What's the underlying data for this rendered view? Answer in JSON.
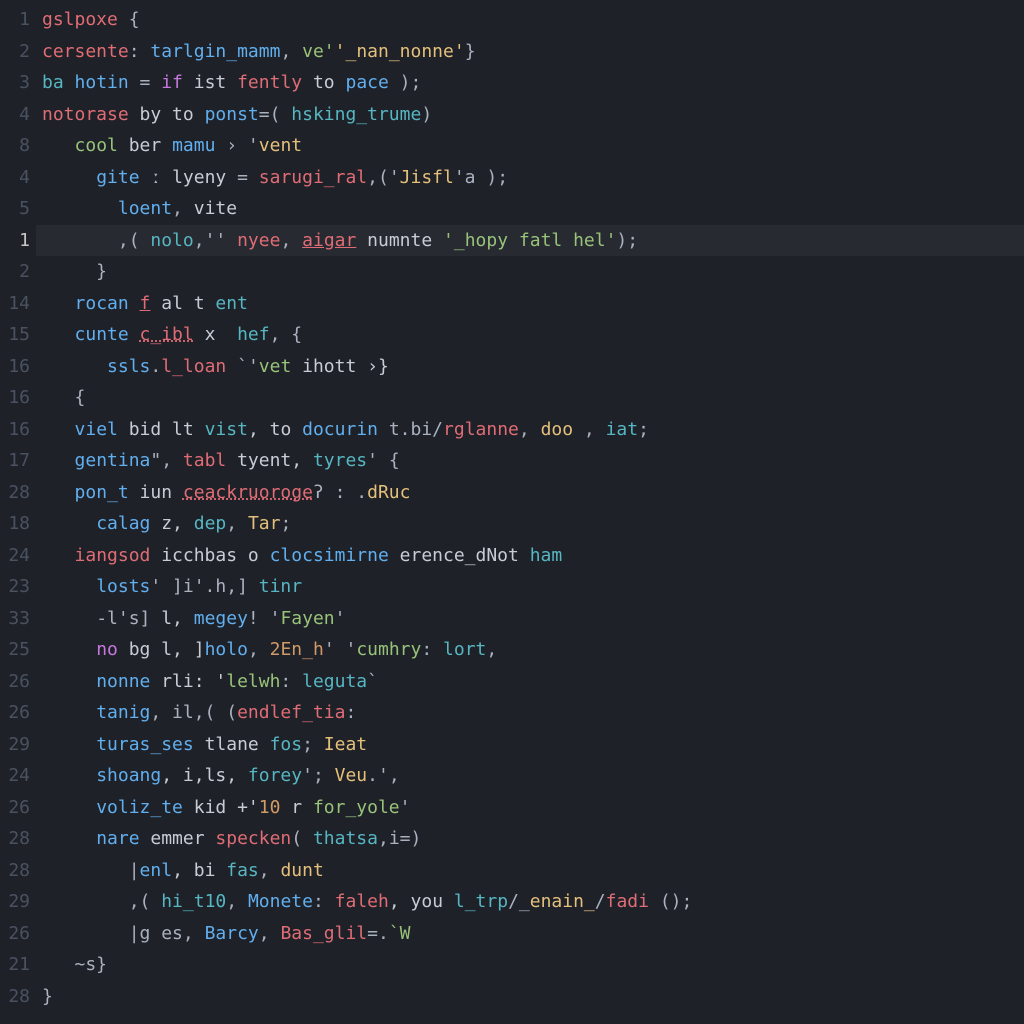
{
  "theme": {
    "background": "#1e2128",
    "gutter": "#4a5260",
    "highlight_row_index": 7
  },
  "lines": [
    {
      "num": "1",
      "tokens": [
        {
          "t": "gslpoxe",
          "c": "var"
        },
        {
          "t": " {",
          "c": "op"
        }
      ]
    },
    {
      "num": "2",
      "tokens": [
        {
          "t": "cersente",
          "c": "var"
        },
        {
          "t": ": ",
          "c": "op"
        },
        {
          "t": "tarlgin_mamm",
          "c": "fn"
        },
        {
          "t": ", ",
          "c": "op"
        },
        {
          "t": "ve'",
          "c": "str"
        },
        {
          "t": "'_nan_nonne'",
          "c": "warn"
        },
        {
          "t": "}",
          "c": "op"
        }
      ]
    },
    {
      "num": "3",
      "tokens": [
        {
          "t": "ba ",
          "c": "id"
        },
        {
          "t": "hotin",
          "c": "fn"
        },
        {
          "t": " = ",
          "c": "op"
        },
        {
          "t": "if",
          "c": "kw"
        },
        {
          "t": " ist ",
          "c": "mut"
        },
        {
          "t": "fently",
          "c": "var"
        },
        {
          "t": " to ",
          "c": "mut"
        },
        {
          "t": "pace",
          "c": "fn"
        },
        {
          "t": " );",
          "c": "op"
        }
      ]
    },
    {
      "num": "4",
      "tokens": [
        {
          "t": "notorase",
          "c": "var"
        },
        {
          "t": " by to ",
          "c": "mut"
        },
        {
          "t": "ponst",
          "c": "fn"
        },
        {
          "t": "=( ",
          "c": "op"
        },
        {
          "t": "hsking_trume",
          "c": "id"
        },
        {
          "t": ")",
          "c": "op"
        }
      ]
    },
    {
      "num": "8",
      "tokens": [
        {
          "t": "   ",
          "c": "op"
        },
        {
          "t": "cool",
          "c": "str"
        },
        {
          "t": " ber ",
          "c": "mut"
        },
        {
          "t": "mamu",
          "c": "fn"
        },
        {
          "t": " › '",
          "c": "op"
        },
        {
          "t": "vent",
          "c": "warn"
        }
      ]
    },
    {
      "num": "4",
      "tokens": [
        {
          "t": "     ",
          "c": "op"
        },
        {
          "t": "gite",
          "c": "fn"
        },
        {
          "t": " ː ",
          "c": "op"
        },
        {
          "t": "lyeny",
          "c": "mut"
        },
        {
          "t": " = ",
          "c": "op"
        },
        {
          "t": "sarugi_ral",
          "c": "var"
        },
        {
          "t": ",('",
          "c": "op"
        },
        {
          "t": "Jisfl",
          "c": "warn"
        },
        {
          "t": "'a );",
          "c": "op"
        }
      ]
    },
    {
      "num": "5",
      "tokens": [
        {
          "t": "       ",
          "c": "op"
        },
        {
          "t": "loent",
          "c": "fn"
        },
        {
          "t": ", ",
          "c": "op"
        },
        {
          "t": "vite",
          "c": "mut"
        }
      ]
    },
    {
      "num": "1",
      "tokens": [
        {
          "t": "       ,( ",
          "c": "op"
        },
        {
          "t": "nolo",
          "c": "id"
        },
        {
          "t": ",'' ",
          "c": "op"
        },
        {
          "t": "nyee",
          "c": "var"
        },
        {
          "t": ", ",
          "c": "op"
        },
        {
          "t": "aigar",
          "c": "var und"
        },
        {
          "t": " numnte ",
          "c": "mut"
        },
        {
          "t": "'_hopy fatl hel'",
          "c": "str"
        },
        {
          "t": ");",
          "c": "op"
        }
      ]
    },
    {
      "num": "2",
      "tokens": [
        {
          "t": "     }",
          "c": "op"
        }
      ]
    },
    {
      "num": "14",
      "tokens": [
        {
          "t": "   ",
          "c": "op"
        },
        {
          "t": "rocan ",
          "c": "fn"
        },
        {
          "t": "f",
          "c": "var und"
        },
        {
          "t": " al t ",
          "c": "mut"
        },
        {
          "t": "ent",
          "c": "id"
        }
      ]
    },
    {
      "num": "15",
      "tokens": [
        {
          "t": "   ",
          "c": "op"
        },
        {
          "t": "cunte ",
          "c": "fn"
        },
        {
          "t": "c_ibl",
          "c": "var und2"
        },
        {
          "t": " x  ",
          "c": "mut"
        },
        {
          "t": "hef",
          "c": "id"
        },
        {
          "t": ", {",
          "c": "op"
        }
      ]
    },
    {
      "num": "16",
      "tokens": [
        {
          "t": "      ",
          "c": "op"
        },
        {
          "t": "ssls",
          "c": "fn"
        },
        {
          "t": ".",
          "c": "op"
        },
        {
          "t": "l_loan",
          "c": "var"
        },
        {
          "t": " `'",
          "c": "op"
        },
        {
          "t": "vet",
          "c": "str"
        },
        {
          "t": " ihott ›}",
          "c": "mut"
        }
      ]
    },
    {
      "num": "16",
      "tokens": [
        {
          "t": "   {",
          "c": "op"
        }
      ]
    },
    {
      "num": "16",
      "tokens": [
        {
          "t": "   ",
          "c": "op"
        },
        {
          "t": "viel",
          "c": "fn"
        },
        {
          "t": " bid lt ",
          "c": "mut"
        },
        {
          "t": "vist",
          "c": "id"
        },
        {
          "t": ", to ",
          "c": "mut"
        },
        {
          "t": "docurin",
          "c": "fn"
        },
        {
          "t": " t.bi/",
          "c": "op"
        },
        {
          "t": "rglanne",
          "c": "var"
        },
        {
          "t": ", ",
          "c": "op"
        },
        {
          "t": "doo",
          "c": "warn"
        },
        {
          "t": " , ",
          "c": "op"
        },
        {
          "t": "iat",
          "c": "id"
        },
        {
          "t": ";",
          "c": "op"
        }
      ]
    },
    {
      "num": "17",
      "tokens": [
        {
          "t": "   ",
          "c": "op"
        },
        {
          "t": "gentina",
          "c": "fn"
        },
        {
          "t": "\", ",
          "c": "op"
        },
        {
          "t": "tabl",
          "c": "var"
        },
        {
          "t": " tyent, ",
          "c": "mut"
        },
        {
          "t": "tyres",
          "c": "id"
        },
        {
          "t": "' {",
          "c": "op"
        }
      ]
    },
    {
      "num": "28",
      "tokens": [
        {
          "t": "   ",
          "c": "op"
        },
        {
          "t": "pon_t",
          "c": "fn"
        },
        {
          "t": " iun ",
          "c": "mut"
        },
        {
          "t": "ceackruoroge",
          "c": "var und2"
        },
        {
          "t": "ʔ : .",
          "c": "op"
        },
        {
          "t": "dRuc",
          "c": "warn"
        }
      ]
    },
    {
      "num": "18",
      "tokens": [
        {
          "t": "     ",
          "c": "op"
        },
        {
          "t": "calag",
          "c": "fn"
        },
        {
          "t": " z, ",
          "c": "mut"
        },
        {
          "t": "dep",
          "c": "id"
        },
        {
          "t": ", ",
          "c": "op"
        },
        {
          "t": "Tar",
          "c": "warn"
        },
        {
          "t": ";",
          "c": "op"
        }
      ]
    },
    {
      "num": "24",
      "tokens": [
        {
          "t": "   ",
          "c": "op"
        },
        {
          "t": "iangsod",
          "c": "var"
        },
        {
          "t": " icchbas o ",
          "c": "mut"
        },
        {
          "t": "clocsimirne",
          "c": "fn"
        },
        {
          "t": " erence_dNot ",
          "c": "mut"
        },
        {
          "t": "ham",
          "c": "id"
        }
      ]
    },
    {
      "num": "23",
      "tokens": [
        {
          "t": "     ",
          "c": "op"
        },
        {
          "t": "losts",
          "c": "fn"
        },
        {
          "t": "' ]i'.h,] ",
          "c": "op"
        },
        {
          "t": "tinr",
          "c": "id"
        }
      ]
    },
    {
      "num": "33",
      "tokens": [
        {
          "t": "     ",
          "c": "op"
        },
        {
          "t": "-l's]",
          "c": "op"
        },
        {
          "t": " l, ",
          "c": "mut"
        },
        {
          "t": "megey",
          "c": "fn"
        },
        {
          "t": "! '",
          "c": "op"
        },
        {
          "t": "Fayen",
          "c": "str"
        },
        {
          "t": "'",
          "c": "op"
        }
      ]
    },
    {
      "num": "25",
      "tokens": [
        {
          "t": "     ",
          "c": "op"
        },
        {
          "t": "no",
          "c": "kw"
        },
        {
          "t": " bg l, ]",
          "c": "mut"
        },
        {
          "t": "holo",
          "c": "fn"
        },
        {
          "t": ", ",
          "c": "op"
        },
        {
          "t": "2En_h",
          "c": "num"
        },
        {
          "t": "' '",
          "c": "op"
        },
        {
          "t": "cumhry",
          "c": "str"
        },
        {
          "t": ": ",
          "c": "op"
        },
        {
          "t": "lort",
          "c": "id"
        },
        {
          "t": ",",
          "c": "op"
        }
      ]
    },
    {
      "num": "26",
      "tokens": [
        {
          "t": "     ",
          "c": "op"
        },
        {
          "t": "nonne",
          "c": "fn"
        },
        {
          "t": " rli: '",
          "c": "mut"
        },
        {
          "t": "lelwh",
          "c": "str"
        },
        {
          "t": ": ",
          "c": "op"
        },
        {
          "t": "leguta",
          "c": "id"
        },
        {
          "t": "`",
          "c": "op"
        }
      ]
    },
    {
      "num": "26",
      "tokens": [
        {
          "t": "     ",
          "c": "op"
        },
        {
          "t": "tanig",
          "c": "fn"
        },
        {
          "t": ", il,( (",
          "c": "op"
        },
        {
          "t": "endlef_tia",
          "c": "var"
        },
        {
          "t": ":",
          "c": "op"
        }
      ]
    },
    {
      "num": "29",
      "tokens": [
        {
          "t": "     ",
          "c": "op"
        },
        {
          "t": "turas_ses",
          "c": "fn"
        },
        {
          "t": " tlane ",
          "c": "mut"
        },
        {
          "t": "fos",
          "c": "id"
        },
        {
          "t": "; ",
          "c": "op"
        },
        {
          "t": "Ieat",
          "c": "warn"
        }
      ]
    },
    {
      "num": "24",
      "tokens": [
        {
          "t": "     ",
          "c": "op"
        },
        {
          "t": "shoang",
          "c": "fn"
        },
        {
          "t": ", i,ls, ",
          "c": "mut"
        },
        {
          "t": "forey",
          "c": "id"
        },
        {
          "t": "'; ",
          "c": "op"
        },
        {
          "t": "Veu",
          "c": "warn"
        },
        {
          "t": ".',",
          "c": "op"
        }
      ]
    },
    {
      "num": "26",
      "tokens": [
        {
          "t": "     ",
          "c": "op"
        },
        {
          "t": "voliz_te",
          "c": "fn"
        },
        {
          "t": " kid +'",
          "c": "mut"
        },
        {
          "t": "10",
          "c": "num"
        },
        {
          "t": " r ",
          "c": "mut"
        },
        {
          "t": "for_yole",
          "c": "str"
        },
        {
          "t": "'",
          "c": "op"
        }
      ]
    },
    {
      "num": "28",
      "tokens": [
        {
          "t": "     ",
          "c": "op"
        },
        {
          "t": "nare",
          "c": "fn"
        },
        {
          "t": " emmer ",
          "c": "mut"
        },
        {
          "t": "specken",
          "c": "var"
        },
        {
          "t": "( ",
          "c": "op"
        },
        {
          "t": "thatsa",
          "c": "id"
        },
        {
          "t": ",i=)",
          "c": "op"
        }
      ]
    },
    {
      "num": "28",
      "tokens": [
        {
          "t": "        |",
          "c": "op"
        },
        {
          "t": "enl",
          "c": "fn"
        },
        {
          "t": ", bi ",
          "c": "mut"
        },
        {
          "t": "fas",
          "c": "id"
        },
        {
          "t": ", ",
          "c": "op"
        },
        {
          "t": "dunt",
          "c": "warn"
        }
      ]
    },
    {
      "num": "29",
      "tokens": [
        {
          "t": "        ,( ",
          "c": "op"
        },
        {
          "t": "hi_t10",
          "c": "id"
        },
        {
          "t": ", ",
          "c": "op"
        },
        {
          "t": "Monete",
          "c": "fn"
        },
        {
          "t": ": ",
          "c": "op"
        },
        {
          "t": "faleh",
          "c": "var"
        },
        {
          "t": ", you ",
          "c": "mut"
        },
        {
          "t": "l_trp",
          "c": "id"
        },
        {
          "t": "/_",
          "c": "op"
        },
        {
          "t": "enain_",
          "c": "warn"
        },
        {
          "t": "/",
          "c": "op"
        },
        {
          "t": "fadi",
          "c": "var"
        },
        {
          "t": " ();",
          "c": "op"
        }
      ]
    },
    {
      "num": "26",
      "tokens": [
        {
          "t": "        |g es, ",
          "c": "op"
        },
        {
          "t": "Barcy",
          "c": "fn"
        },
        {
          "t": ", ",
          "c": "op"
        },
        {
          "t": "Bas_glil",
          "c": "var"
        },
        {
          "t": "=.",
          "c": "op"
        },
        {
          "t": "`W",
          "c": "str"
        }
      ]
    },
    {
      "num": "21",
      "tokens": [
        {
          "t": "   ~s}",
          "c": "op"
        }
      ]
    },
    {
      "num": "28",
      "tokens": [
        {
          "t": "}",
          "c": "op"
        }
      ]
    }
  ]
}
